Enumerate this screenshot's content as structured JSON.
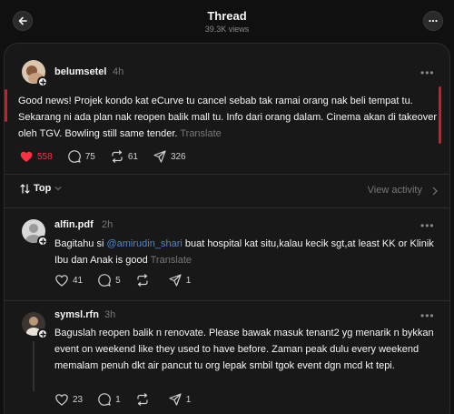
{
  "header": {
    "title": "Thread",
    "views": "39.3K views"
  },
  "main_post": {
    "username": "belumsetel",
    "time": "4h",
    "text": "Good news! Projek kondo kat eCurve tu cancel sebab tak ramai orang nak beli tempat tu. Sekarang ni ada plan nak reopen balik mall tu. Info dari orang dalam. Cinema akan di takeover oleh TGV. Bowling still same tender.",
    "translate": "Translate",
    "likes": "558",
    "replies": "75",
    "reposts": "61",
    "shares": "326",
    "liked_color": "#ff3040"
  },
  "sort": {
    "label": "Top",
    "view_activity": "View activity"
  },
  "replies": [
    {
      "username": "alfin.pdf",
      "time": "2h",
      "text_before": "Bagitahu si ",
      "mention": "@amirudin_shari",
      "text_after": " buat hospital kat situ,kalau kecik sgt,at least KK or Klinik Ibu dan Anak is good",
      "translate": "Translate",
      "likes": "41",
      "replies": "5",
      "reposts": "",
      "shares": "1"
    },
    {
      "username": "symsl.rfn",
      "time": "3h",
      "text": "Baguslah reopen balik n renovate. Please bawak masuk tenant2 yg menarik n bykkan event on weekend like they used to have before. Zaman peak dulu every weekend memalam penuh dkt air pancut tu org lepak smbil tgok event dgn mcd kt tepi.",
      "likes": "23",
      "replies": "1",
      "reposts": "",
      "shares": "1"
    }
  ],
  "icons": [
    "back-arrow-icon",
    "more-icon",
    "heart-icon",
    "comment-icon",
    "repost-icon",
    "share-icon",
    "sort-icon",
    "chevron-down-icon",
    "plus-icon",
    "default-avatar-icon"
  ]
}
